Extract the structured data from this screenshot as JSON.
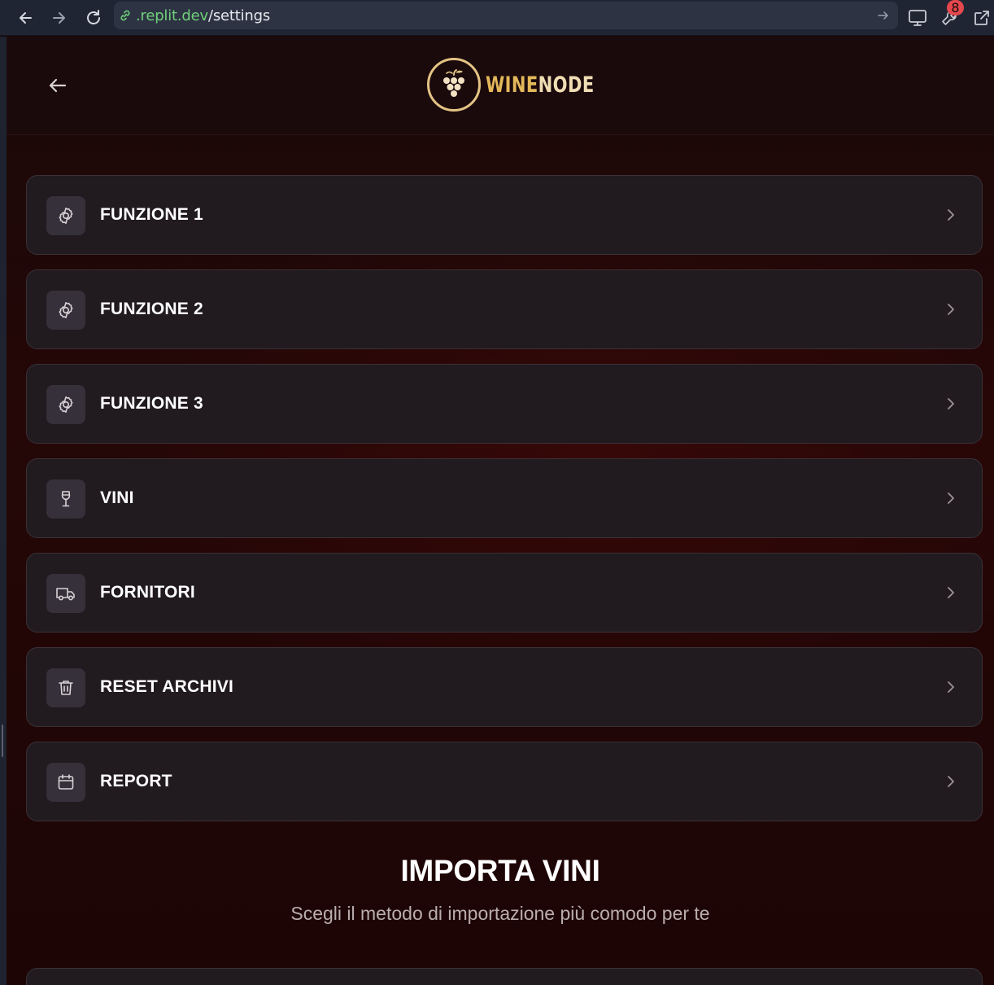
{
  "browser": {
    "url_domain": ".replit.dev",
    "url_path": "/settings",
    "badge_count": "8"
  },
  "header": {
    "logo_word1": "WINE",
    "logo_word2": "NODE"
  },
  "menu": [
    {
      "label": "FUNZIONE 1",
      "icon": "gear-icon"
    },
    {
      "label": "FUNZIONE 2",
      "icon": "gear-icon"
    },
    {
      "label": "FUNZIONE 3",
      "icon": "gear-icon"
    },
    {
      "label": "VINI",
      "icon": "wine-glass-icon"
    },
    {
      "label": "FORNITORI",
      "icon": "truck-icon"
    },
    {
      "label": "RESET ARCHIVI",
      "icon": "trash-icon"
    },
    {
      "label": "REPORT",
      "icon": "calendar-icon"
    }
  ],
  "import_section": {
    "title": "IMPORTA VINI",
    "subtitle": "Scegli il metodo di importazione più comodo per te"
  },
  "colors": {
    "accent_gold": "#e3b85a",
    "card_bg": "#211a1f",
    "background": "#250707"
  }
}
